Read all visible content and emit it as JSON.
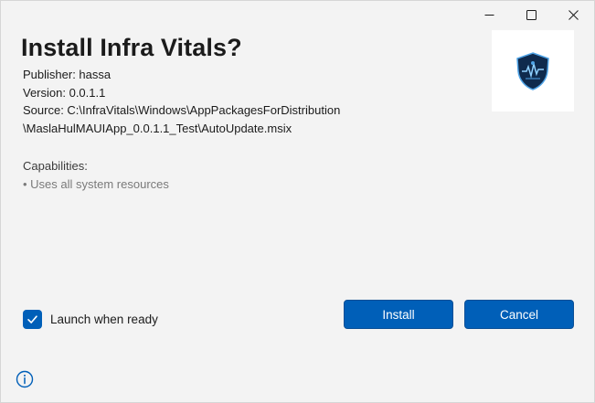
{
  "dialog": {
    "title": "Install Infra Vitals?",
    "publisher": "Publisher: hassa",
    "version": "Version: 0.0.1.1",
    "source_line1": "Source: C:\\InfraVitals\\Windows\\AppPackagesForDistribution",
    "source_line2": "\\MaslaHulMAUIApp_0.0.1.1_Test\\AutoUpdate.msix",
    "capabilities_heading": "Capabilities:",
    "capabilities": [
      "• Uses all system resources"
    ],
    "launch_label": "Launch when ready",
    "launch_checked": true,
    "install_label": "Install",
    "cancel_label": "Cancel"
  },
  "titlebar": {
    "icons": [
      "minimize-icon",
      "maximize-icon",
      "close-icon"
    ]
  },
  "colors": {
    "accent": "#005fb8",
    "background": "#f3f3f3",
    "logo_shield": "#0f2a4d",
    "logo_glow": "#4fa3e6"
  }
}
